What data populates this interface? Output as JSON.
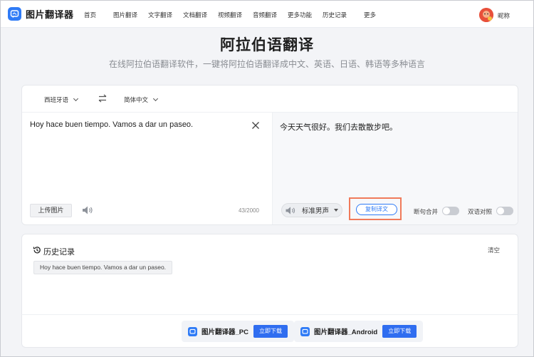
{
  "brand": {
    "name": "图片翻译器"
  },
  "nav": {
    "items": [
      {
        "id": "home",
        "label": "首页"
      },
      {
        "id": "image",
        "label": "图片翻译"
      },
      {
        "id": "text",
        "label": "文字翻译"
      },
      {
        "id": "doc",
        "label": "文档翻译"
      },
      {
        "id": "video",
        "label": "视频翻译"
      },
      {
        "id": "audio",
        "label": "音频翻译"
      },
      {
        "id": "more-func",
        "label": "更多功能"
      },
      {
        "id": "history",
        "label": "历史记录"
      },
      {
        "id": "more",
        "label": "更多"
      }
    ],
    "user_nickname": "昵称"
  },
  "hero": {
    "title": "阿拉伯语翻译",
    "subtitle": "在线阿拉伯语翻译软件，一键将阿拉伯语翻译成中文、英语、日语、韩语等多种语言"
  },
  "translator": {
    "source_lang": "西班牙语",
    "target_lang": "简体中文",
    "source_text": "Hoy hace buen tiempo. Vamos a dar un paseo.",
    "target_text": "今天天气很好。我们去散散步吧。",
    "upload_label": "上传图片",
    "char_count": "43/2000",
    "voice": "标准男声",
    "copy_label": "复制译文",
    "toggle_merge_label": "断句合并",
    "toggle_bilingual_label": "双语对照"
  },
  "history": {
    "title": "历史记录",
    "clear_label": "清空",
    "items": [
      "Hoy hace buen tiempo. Vamos a dar un paseo."
    ]
  },
  "downloads": [
    {
      "name": "图片翻译器_PC",
      "button": "立即下载"
    },
    {
      "name": "图片翻译器_Android",
      "button": "立即下载"
    }
  ],
  "colors": {
    "accent": "#2f7bf6",
    "highlight": "#f07a5a",
    "background": "#f3f4f7"
  }
}
